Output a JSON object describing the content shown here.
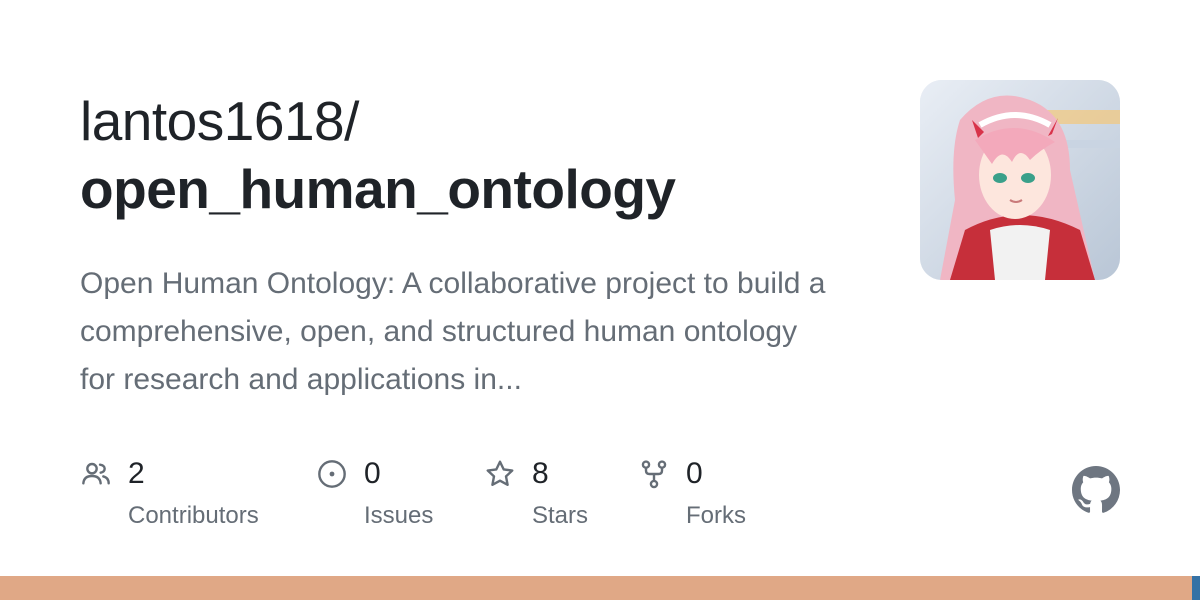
{
  "repo": {
    "owner": "lantos1618/",
    "name": "open_human_ontology",
    "description": "Open Human Ontology: A collaborative project to build a comprehensive, open, and structured human ontology for research and applications in..."
  },
  "avatar": {
    "icon": "avatar-image"
  },
  "stats": {
    "contributors": {
      "count": "2",
      "label": "Contributors",
      "icon": "people-icon"
    },
    "issues": {
      "count": "0",
      "label": "Issues",
      "icon": "issue-opened-icon"
    },
    "stars": {
      "count": "8",
      "label": "Stars",
      "icon": "star-icon"
    },
    "forks": {
      "count": "0",
      "label": "Forks",
      "icon": "repo-forked-icon"
    }
  },
  "brand": {
    "icon": "github-mark-icon",
    "color": "#6e7681"
  },
  "languages": [
    {
      "color": "#e0a886",
      "share": 0.993
    },
    {
      "color": "#3572a5",
      "share": 0.007
    }
  ],
  "colors": {
    "text_primary": "#1f2328",
    "text_secondary": "#656d76"
  }
}
